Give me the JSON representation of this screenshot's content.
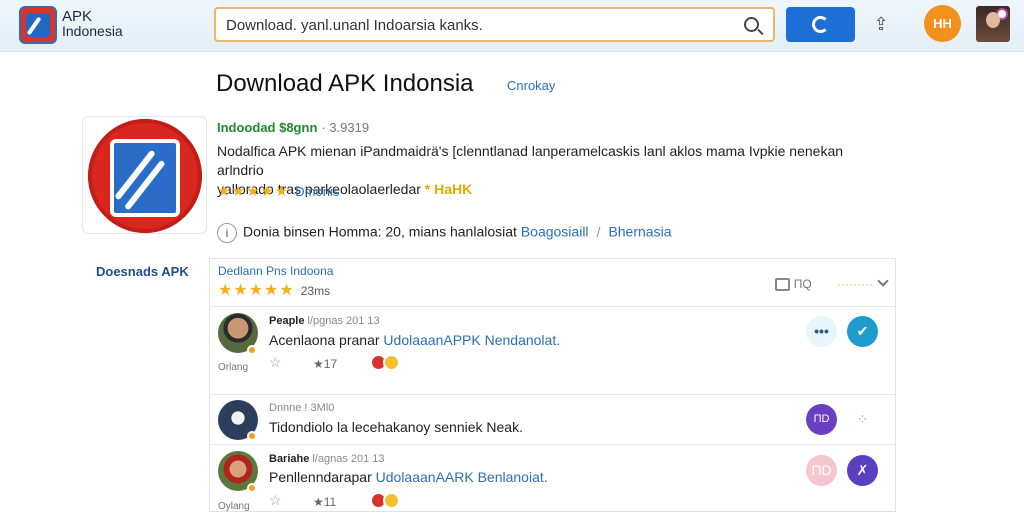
{
  "header": {
    "brand_line1": "APK",
    "brand_line2": "Indonesia",
    "search_value": "Download. yanl.unanl Indoarsia kanks.",
    "avatar_initials": "HH"
  },
  "page": {
    "title": "Download APK Indonsia",
    "category": "Cnrokay"
  },
  "app": {
    "developer": "Indoodad $8gnn",
    "developer_meta": "· 3.9319",
    "description_line1": "Nodalfica APK mienan iPandmaidrä's [clenntlanad lanperamelcaskis lanl aklos mama Ivpkie nenekan arlndrio",
    "description_line2": "yallorado tras parkeolaolaerledar",
    "description_highlight": "* HaHK",
    "stars": "★★★★★",
    "rating_label": "Dmonis",
    "info_text": "Donia binsen Homma: 20, mians hanlalosiat",
    "info_link1": "Boagosiaill",
    "info_sep": "/",
    "info_link2": "Bhernasia",
    "info_icon": "i"
  },
  "sidebar": {
    "label": "Doesnads APK"
  },
  "reviews_panel": {
    "title": "Dedlann Pns Indoona",
    "stars": "★★★★★",
    "count": "23ms",
    "tool_count": "ПQ",
    "sort_label": "·········"
  },
  "reviews": [
    {
      "name": "Peaple",
      "meta": "l/pgnas 201 13",
      "text_prefix": "Acenlaona pranar ",
      "text_link": "UdolaaanAPPK Nendanolat.",
      "under": "Orlang",
      "likes": "17",
      "more_label": "•••",
      "edit_label": "✔"
    },
    {
      "name": "Dnnne",
      "meta": "! 3Ml0",
      "text_prefix": "Tidondiolo la lecehakanoy senniek Neak.",
      "text_link": "",
      "icon_label": "ПD",
      "load_label": "⁘"
    },
    {
      "name": "Bariahe",
      "meta": "l/agnas 201 13",
      "text_prefix": "Penllenndarapar ",
      "text_link": "UdolaaanAARK Benlanoiat.",
      "under": "Oylang",
      "likes": "11",
      "pink_label": "ПD",
      "violet_label": "✗"
    }
  ],
  "colors": {
    "brand_blue": "#1d6fd6",
    "accent_orange": "#f4901e",
    "star": "#f2b01e",
    "link": "#2a6fb8",
    "developer_green": "#1e8a2e"
  },
  "icons": [
    "apk-logo-icon",
    "search-icon",
    "refresh-icon",
    "share-icon",
    "info-icon",
    "chat-icon",
    "chevron-down-icon",
    "star-icon",
    "more-icon",
    "edit-icon"
  ]
}
